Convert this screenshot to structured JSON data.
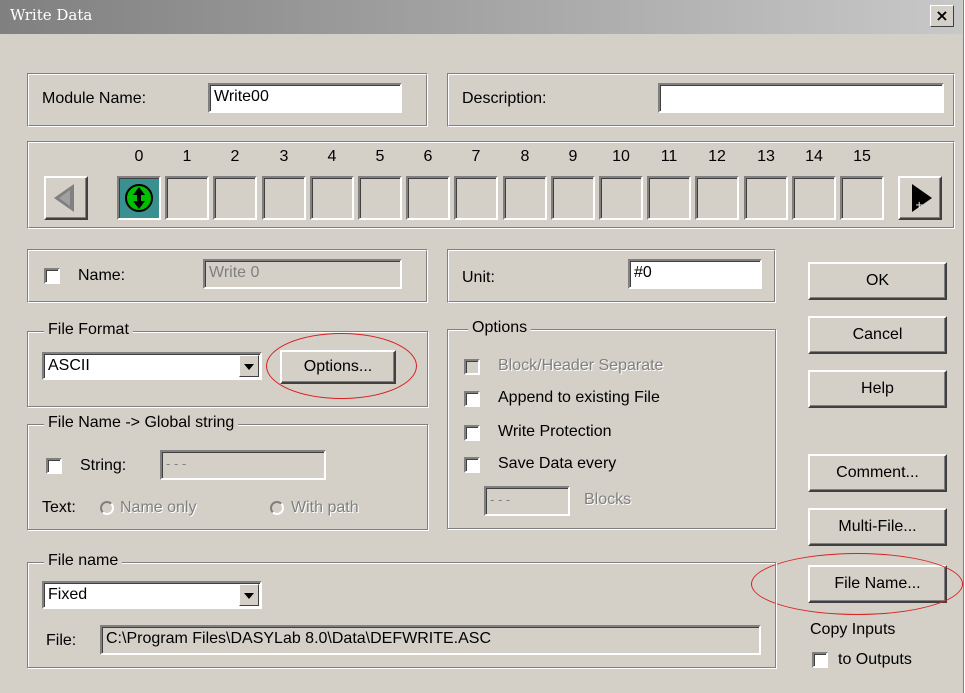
{
  "window": {
    "title": "Write Data",
    "close_symbol": "×"
  },
  "module": {
    "name_label": "Module Name:",
    "name_value": "Write00",
    "description_label": "Description:",
    "description_value": ""
  },
  "channels": {
    "numbers": [
      "0",
      "1",
      "2",
      "3",
      "4",
      "5",
      "6",
      "7",
      "8",
      "9",
      "10",
      "11",
      "12",
      "13",
      "14",
      "15"
    ],
    "active_index": 0
  },
  "name_row": {
    "label": "Name:",
    "value": "Write 0",
    "checked": false
  },
  "unit": {
    "label": "Unit:",
    "value": "#0"
  },
  "buttons": {
    "ok": "OK",
    "cancel": "Cancel",
    "help": "Help",
    "comment": "Comment...",
    "multi_file": "Multi-File...",
    "file_name": "File Name..."
  },
  "file_format": {
    "legend": "File Format",
    "selected": "ASCII",
    "options_button": "Options..."
  },
  "options": {
    "legend": "Options",
    "block_header": "Block/Header Separate",
    "append": "Append to existing File",
    "write_protection": "Write Protection",
    "save_data_every": "Save Data every",
    "blocks_value": "- - -",
    "blocks_label": "Blocks"
  },
  "global_string": {
    "legend": "File Name -> Global string",
    "string_label": "String:",
    "string_value": "- - -",
    "text_label": "Text:",
    "name_only": "Name only",
    "with_path": "With path"
  },
  "file_name": {
    "legend": "File name",
    "mode": "Fixed",
    "file_label": "File:",
    "path": "C:\\Program Files\\DASYLab 8.0\\Data\\DEFWRITE.ASC"
  },
  "copy_inputs": {
    "line1": "Copy Inputs",
    "line2": "to Outputs"
  },
  "colors": {
    "highlight_ellipse": "#d92020",
    "active_channel": "#00c000"
  }
}
